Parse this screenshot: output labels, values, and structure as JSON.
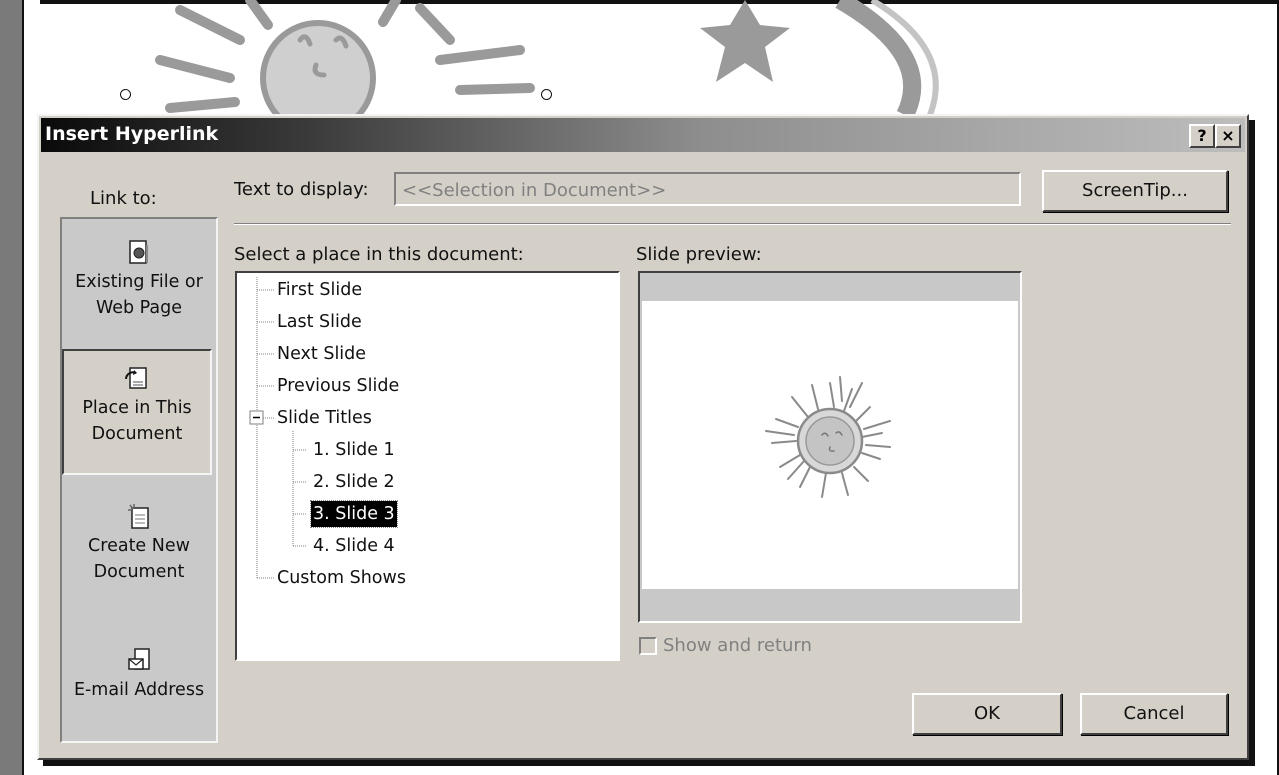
{
  "dialog": {
    "title": "Insert Hyperlink",
    "help_button": "?",
    "close_button": "×",
    "link_to_label": "Link to:"
  },
  "nav": {
    "existing_file_line1": "Existing File or",
    "existing_file_line2": "Web Page",
    "place_line1": "Place in This",
    "place_line2": "Document",
    "create_new_line1": "Create New",
    "create_new_line2": "Document",
    "email_line1": "E-mail Address"
  },
  "form": {
    "text_to_display_label": "Text to display:",
    "text_to_display_value": "<<Selection in Document>>",
    "screentip_button": "ScreenTip...",
    "select_place_label": "Select a place in this document:",
    "slide_preview_label": "Slide preview:",
    "show_and_return_label": "Show and return",
    "ok_button": "OK",
    "cancel_button": "Cancel"
  },
  "tree": {
    "items": [
      {
        "label": "First Slide"
      },
      {
        "label": "Last Slide"
      },
      {
        "label": "Next Slide"
      },
      {
        "label": "Previous Slide"
      },
      {
        "label": "Slide Titles"
      },
      {
        "label": "1. Slide 1"
      },
      {
        "label": "2. Slide 2"
      },
      {
        "label": "3. Slide 3"
      },
      {
        "label": "4. Slide 4"
      },
      {
        "label": "Custom Shows"
      }
    ],
    "selected_item": "3. Slide 3",
    "expanded_node": "Slide Titles"
  },
  "icons": {
    "existing_file": "document-globe-icon",
    "place_in_document": "document-arrow-icon",
    "create_new": "new-document-icon",
    "email": "envelope-document-icon",
    "collapse": "minus-box-icon"
  },
  "colors": {
    "dialog_face": "#d4d0c8",
    "titlebar_start": "#0a0a0a",
    "titlebar_end": "#bdbdbd",
    "selection": "#000000"
  }
}
